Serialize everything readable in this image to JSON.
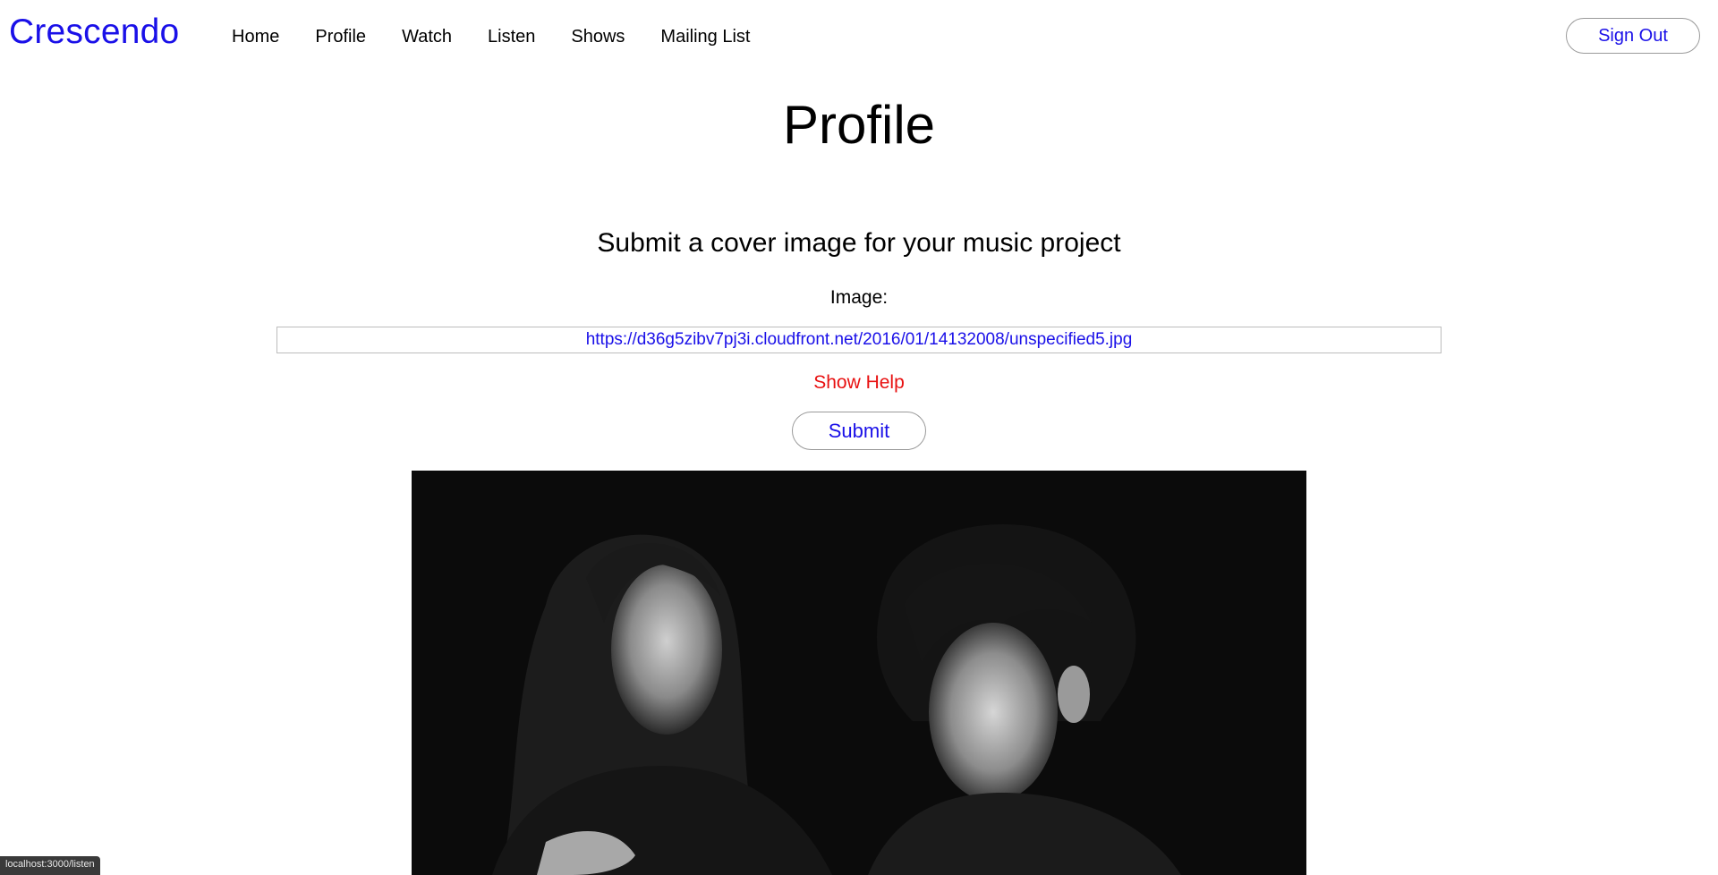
{
  "brand": "Crescendo",
  "nav": {
    "items": [
      {
        "label": "Home"
      },
      {
        "label": "Profile"
      },
      {
        "label": "Watch"
      },
      {
        "label": "Listen"
      },
      {
        "label": "Shows"
      },
      {
        "label": "Mailing List"
      }
    ],
    "sign_out_label": "Sign Out"
  },
  "page": {
    "title": "Profile",
    "section_heading": "Submit a cover image for your music project",
    "image_label": "Image:",
    "image_url_value": "https://d36g5zibv7pj3i.cloudfront.net/2016/01/14132008/unspecified5.jpg",
    "show_help_label": "Show Help",
    "submit_label": "Submit"
  },
  "status_bar": {
    "url": "localhost:3000/listen"
  },
  "colors": {
    "accent": "#1a10e8",
    "help": "#e81010"
  }
}
